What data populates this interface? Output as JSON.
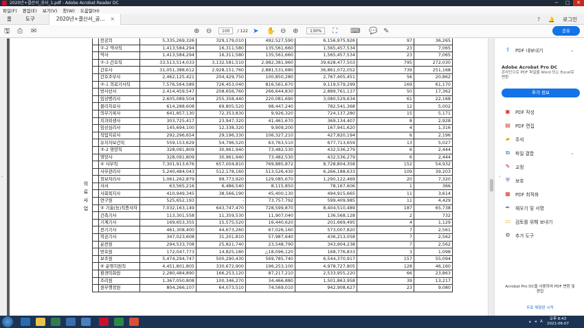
{
  "window": {
    "title": "2020년+결산서_공사_1.pdf - Adobe Acrobat Reader DC",
    "controls": [
      "−",
      "□",
      "✕"
    ]
  },
  "menu": [
    "파일(F)",
    "편집(E)",
    "보기(V)",
    "창(W)",
    "도움말(H)"
  ],
  "tabs": {
    "home": "홈",
    "tools": "도구",
    "doc": "2020년+결산서_공...",
    "login": "로그인"
  },
  "toolbar": {
    "page_current": "100",
    "page_total": "/ 122",
    "zoom": "130%",
    "share": "공유"
  },
  "side_label": "의\n료\n사\n업",
  "table_rows": [
    [
      "",
      "전공의",
      "5,335,269,326",
      "329,179,010",
      "492,527,590",
      "6,156,975,926",
      "97",
      "36,265"
    ],
    [
      "",
      "②-2 약사직",
      "1,413,584,294",
      "16,311,580",
      "135,561,660",
      "1,565,457,534",
      "23",
      "7,065"
    ],
    [
      "",
      "약사",
      "1,413,584,294",
      "16,311,580",
      "135,561,660",
      "1,565,457,534",
      "23",
      "7,065"
    ],
    [
      "",
      "②-3 간호직",
      "33,513,514,033",
      "3,132,581,510",
      "2,982,381,960",
      "39,628,477,503",
      "795",
      "272,030"
    ],
    [
      "",
      "간호사",
      "31,051,388,612",
      "2,928,151,760",
      "2,881,531,680",
      "36,861,072,052",
      "739",
      "251,168"
    ],
    [
      "",
      "간호조무사",
      "2,462,125,421",
      "204,429,750",
      "100,850,280",
      "2,767,405,451",
      "56",
      "20,862"
    ],
    [
      "",
      "③-1 의료기사직",
      "7,576,564,589",
      "726,453,040",
      "816,561,670",
      "9,119,579,299",
      "169",
      "61,170"
    ],
    [
      "",
      "방사선사",
      "2,414,459,547",
      "208,656,760",
      "266,644,830",
      "2,889,761,137",
      "50",
      "17,362"
    ],
    [
      "",
      "임상병리사",
      "2,605,089,504",
      "255,358,440",
      "220,081,690",
      "3,080,529,634",
      "61",
      "22,168"
    ],
    [
      "",
      "물리치료사",
      "614,288,608",
      "69,805,520",
      "98,447,240",
      "782,541,368",
      "12",
      "5,002"
    ],
    [
      "",
      "의무기록사",
      "641,857,130",
      "72,353,830",
      "9,926,320",
      "724,137,280",
      "15",
      "5,171"
    ],
    [
      "",
      "치과위생사",
      "303,725,417",
      "23,947,320",
      "41,461,670",
      "369,134,407",
      "8",
      "2,928"
    ],
    [
      "",
      "임상심리사",
      "145,694,100",
      "12,338,320",
      "9,909,200",
      "167,941,620",
      "4",
      "1,316"
    ],
    [
      "",
      "작업치료사",
      "292,296,654",
      "29,196,330",
      "106,327,210",
      "427,820,194",
      "6",
      "2,196"
    ],
    [
      "",
      "유지자보건직",
      "559,153,629",
      "54,796,520",
      "63,763,510",
      "677,713,659",
      "13",
      "5,027"
    ],
    [
      "",
      "③-2 영양직",
      "328,091,809",
      "30,961,940",
      "73,482,530",
      "432,536,279",
      "6",
      "2,444"
    ],
    [
      "",
      "영양사",
      "328,091,809",
      "30,961,940",
      "73,482,530",
      "432,536,279",
      "6",
      "2,444"
    ],
    [
      "",
      "④ 사무직",
      "7,301,913,676",
      "657,004,810",
      "769,885,872",
      "8,728,804,358",
      "152",
      "54,932"
    ],
    [
      "",
      "사무관리사",
      "5,240,484,043",
      "512,178,160",
      "513,526,430",
      "6,266,188,633",
      "109",
      "39,203"
    ],
    [
      "",
      "정보처리사",
      "1,061,262,879",
      "99,773,920",
      "129,085,670",
      "1,290,122,469",
      "20",
      "7,320"
    ],
    [
      "",
      "사서",
      "63,565,216",
      "6,486,540",
      "8,115,850",
      "78,167,606",
      "1",
      "366"
    ],
    [
      "",
      "사회복지사",
      "410,949,345",
      "38,566,190",
      "45,400,130",
      "494,915,665",
      "11",
      "3,614"
    ],
    [
      "",
      "연구원",
      "525,652,193",
      "-",
      "73,757,792",
      "599,409,985",
      "11",
      "4,429"
    ],
    [
      "",
      "⑤ 기술(능)직종사자",
      "7,032,163,149",
      "643,747,470",
      "728,599,870",
      "8,404,510,489",
      "187",
      "65,738"
    ],
    [
      "",
      "건축기사",
      "113,301,558",
      "11,359,530",
      "11,907,040",
      "136,568,128",
      "2",
      "732"
    ],
    [
      "",
      "기계기사",
      "169,653,355",
      "15,575,520",
      "16,440,620",
      "201,669,495",
      "4",
      "1,129"
    ],
    [
      "",
      "전기기사",
      "461,308,400",
      "44,673,260",
      "67,026,160",
      "573,007,820",
      "7",
      "2,561"
    ],
    [
      "",
      "의공기사",
      "347,023,608",
      "31,201,810",
      "57,987,640",
      "436,213,058",
      "7",
      "2,562"
    ],
    [
      "",
      "운전원",
      "294,533,708",
      "25,821,740",
      "23,548,790",
      "343,904,238",
      "7",
      "2,562"
    ],
    [
      "",
      "방호원",
      "172,047,773",
      "14,825,180",
      "△18,096,120",
      "168,776,833",
      "3",
      "1,098"
    ],
    [
      "",
      "보조원",
      "5,474,294,747",
      "500,290,430",
      "569,785,740",
      "6,544,370,917",
      "157",
      "55,094"
    ],
    [
      "",
      "⑥ 운영지원직",
      "4,451,801,805",
      "330,672,900",
      "196,253,100",
      "4,978,727,805",
      "128",
      "46,160"
    ],
    [
      "",
      "환경미화원",
      "2,280,484,890",
      "166,253,120",
      "87,217,210",
      "2,533,955,220",
      "66",
      "23,863"
    ],
    [
      "",
      "조리원",
      "1,367,050,808",
      "100,346,270",
      "34,466,880",
      "1,501,863,958",
      "39",
      "13,217"
    ],
    [
      "",
      "원무행정원",
      "804,266,107",
      "64,073,510",
      "74,569,010",
      "942,908,627",
      "23",
      "9,080"
    ]
  ],
  "right_panel": {
    "export_pdf": "PDF 내보내기",
    "promo_title": "Adobe Acrobat Pro DC",
    "promo_desc": "온라인으로 PDF 파일을 Word 또는 Excel로 변환",
    "promo_btn": "추가 정보",
    "tools": [
      "PDF 작성",
      "PDF 편집",
      "주석",
      "파일 결합",
      "교정",
      "보호",
      "PDF 최적화",
      "채우기 및 서명",
      "검토를 위해 보내기",
      "추가 도구"
    ],
    "bottom_text": "Acrobat Pro DC을 사용하여 PDF 변환 및 편집",
    "bottom_link": "무료 체험판 시작"
  },
  "taskbar": {
    "time": "오후 8:43",
    "date": "2021-06-07"
  }
}
